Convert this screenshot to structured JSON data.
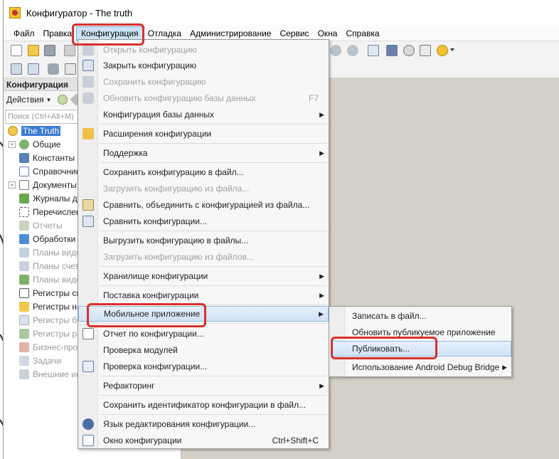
{
  "window": {
    "title": "Конфигуратор - The truth"
  },
  "menubar": {
    "items": [
      "Файл",
      "Правка",
      "Конфигурация",
      "Отладка",
      "Администрирование",
      "Сервис",
      "Окна",
      "Справка"
    ],
    "active": "Конфигурация"
  },
  "left_panel": {
    "title": "Конфигурация",
    "actions_label": "Действия",
    "search_placeholder": "Поиск (Ctrl+Alt+M)",
    "root": "The Truth",
    "tree": [
      {
        "label": "Общие",
        "expandable": true,
        "dim": false
      },
      {
        "label": "Константы",
        "expandable": false,
        "dim": false
      },
      {
        "label": "Справочники",
        "expandable": false,
        "dim": false
      },
      {
        "label": "Документы",
        "expandable": true,
        "dim": false
      },
      {
        "label": "Журналы до",
        "expandable": false,
        "dim": false
      },
      {
        "label": "Перечислен",
        "expandable": false,
        "dim": false
      },
      {
        "label": "Отчеты",
        "expandable": false,
        "dim": true
      },
      {
        "label": "Обработки",
        "expandable": false,
        "dim": false
      },
      {
        "label": "Планы видо",
        "expandable": false,
        "dim": true
      },
      {
        "label": "Планы счето",
        "expandable": false,
        "dim": true
      },
      {
        "label": "Планы видо",
        "expandable": false,
        "dim": true
      },
      {
        "label": "Регистры св",
        "expandable": false,
        "dim": false
      },
      {
        "label": "Регистры на",
        "expandable": false,
        "dim": false
      },
      {
        "label": "Регистры бу",
        "expandable": false,
        "dim": true
      },
      {
        "label": "Регистры ра",
        "expandable": false,
        "dim": true
      },
      {
        "label": "Бизнес-проц",
        "expandable": false,
        "dim": true
      },
      {
        "label": "Задачи",
        "expandable": false,
        "dim": true
      },
      {
        "label": "Внешние ис",
        "expandable": false,
        "dim": true
      }
    ]
  },
  "config_menu": {
    "items": [
      {
        "label": "Открыть конфигурацию",
        "disabled": true,
        "shortcut": "",
        "submenu": false
      },
      {
        "label": "Закрыть конфигурацию",
        "disabled": false,
        "shortcut": "",
        "submenu": false
      },
      {
        "label": "Сохранить конфигурацию",
        "disabled": true,
        "shortcut": "",
        "submenu": false
      },
      {
        "label": "Обновить конфигурацию базы данных",
        "disabled": true,
        "shortcut": "F7",
        "submenu": false
      },
      {
        "label": "Конфигурация базы данных",
        "disabled": false,
        "shortcut": "",
        "submenu": true
      },
      {
        "label": "Расширения конфигурации",
        "disabled": false,
        "shortcut": "",
        "submenu": false
      },
      {
        "label": "Поддержка",
        "disabled": false,
        "shortcut": "",
        "submenu": true
      },
      {
        "label": "Сохранить конфигурацию в файл...",
        "disabled": false,
        "shortcut": "",
        "submenu": false
      },
      {
        "label": "Загрузить конфигурацию из файла...",
        "disabled": true,
        "shortcut": "",
        "submenu": false
      },
      {
        "label": "Сравнить, объединить с конфигурацией из файла...",
        "disabled": false,
        "shortcut": "",
        "submenu": false
      },
      {
        "label": "Сравнить конфигурации...",
        "disabled": false,
        "shortcut": "",
        "submenu": false
      },
      {
        "label": "Выгрузить конфигурацию в файлы...",
        "disabled": false,
        "shortcut": "",
        "submenu": false
      },
      {
        "label": "Загрузить конфигурацию из файлов...",
        "disabled": true,
        "shortcut": "",
        "submenu": false
      },
      {
        "label": "Хранилище конфигурации",
        "disabled": false,
        "shortcut": "",
        "submenu": true
      },
      {
        "label": "Поставка конфигурации",
        "disabled": false,
        "shortcut": "",
        "submenu": true
      },
      {
        "label": "Мобильное приложение",
        "disabled": false,
        "shortcut": "",
        "submenu": true
      },
      {
        "label": "Отчет по конфигурации...",
        "disabled": false,
        "shortcut": "",
        "submenu": false
      },
      {
        "label": "Проверка модулей",
        "disabled": false,
        "shortcut": "",
        "submenu": false
      },
      {
        "label": "Проверка конфигурации...",
        "disabled": false,
        "shortcut": "",
        "submenu": false
      },
      {
        "label": "Рефакторинг",
        "disabled": false,
        "shortcut": "",
        "submenu": true
      },
      {
        "label": "Сохранить идентификатор конфигурации в файл...",
        "disabled": false,
        "shortcut": "",
        "submenu": false
      },
      {
        "label": "Язык редактирования конфигурации...",
        "disabled": false,
        "shortcut": "",
        "submenu": false
      },
      {
        "label": "Окно конфигурации",
        "disabled": false,
        "shortcut": "Ctrl+Shift+C",
        "submenu": false
      }
    ]
  },
  "mobile_submenu": {
    "items": [
      {
        "label": "Записать в файл...",
        "submenu": false
      },
      {
        "label": "Обновить публикуемое приложение",
        "submenu": false
      },
      {
        "label": "Публиковать...",
        "submenu": false
      },
      {
        "label": "Использование Android Debug Bridge",
        "submenu": true
      }
    ]
  },
  "colors": {
    "annotation_red": "#d9302b",
    "highlight_blue": "#cfe2f6",
    "selection_blue": "#3b7bd0"
  }
}
